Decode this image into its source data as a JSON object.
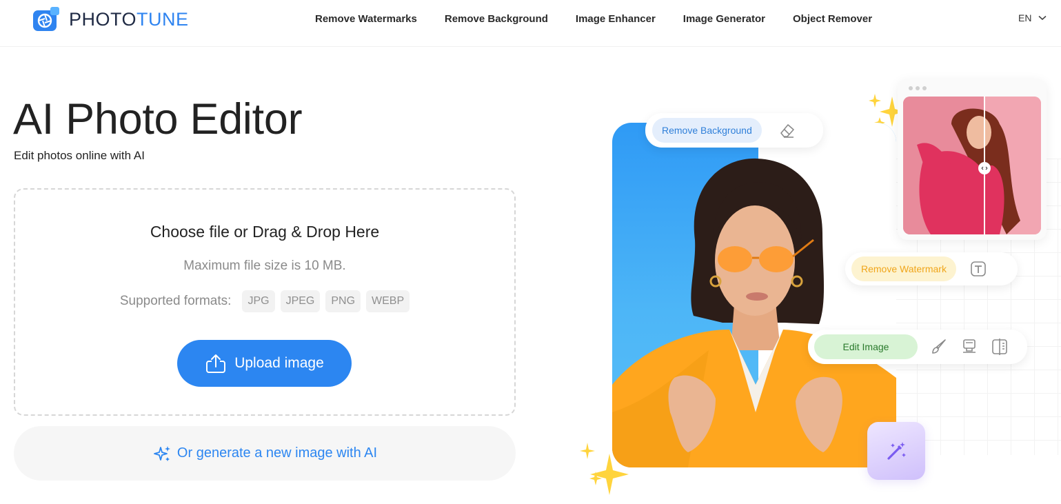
{
  "header": {
    "logo_part1": "PHOTO",
    "logo_part2": "TUNE",
    "nav": [
      {
        "label": "Remove Watermarks"
      },
      {
        "label": "Remove Background"
      },
      {
        "label": "Image Enhancer"
      },
      {
        "label": "Image Generator"
      },
      {
        "label": "Object Remover"
      }
    ],
    "language": "EN"
  },
  "hero": {
    "title": "AI Photo Editor",
    "subtitle": "Edit photos online with AI"
  },
  "upload": {
    "title": "Choose file or Drag & Drop Here",
    "max_size": "Maximum file size is 10 MB.",
    "formats_label": "Supported formats:",
    "formats": [
      "JPG",
      "JPEG",
      "PNG",
      "WEBP"
    ],
    "button_label": "Upload image",
    "generate_label": "Or generate a new image with AI"
  },
  "illustration": {
    "remove_background": "Remove Background",
    "remove_watermark": "Remove Watermark",
    "edit_image": "Edit Image"
  },
  "colors": {
    "accent": "#2c86f1",
    "brand_dark": "#1f2a44",
    "remove_bg_pill": "#e4eefc",
    "remove_watermark_pill": "#fdf3d0",
    "edit_image_pill": "#d8f3d5"
  },
  "icons": {
    "logo": "camera-aperture-icon",
    "language": "chevron-down-icon",
    "upload": "cloud-upload-icon",
    "generate": "sparkles-icon",
    "eraser": "eraser-icon",
    "text": "text-box-icon",
    "brush": "brush-icon",
    "stamp": "stamp-icon",
    "compare": "compare-icon",
    "magic": "magic-wand-icon"
  }
}
